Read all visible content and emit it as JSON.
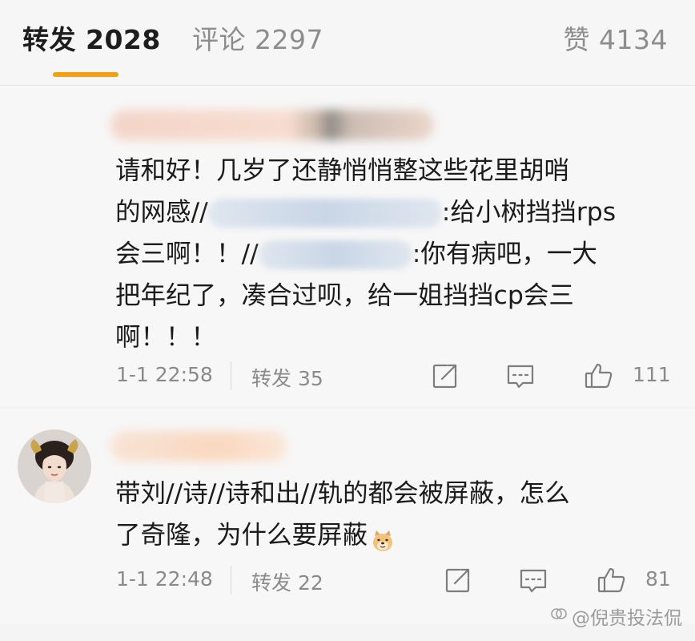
{
  "tabs": {
    "forward": "转发 2028",
    "comments": "评论 2297",
    "likes": "赞 4134"
  },
  "colors": {
    "accent": "#f1a213",
    "text": "#1b1b1b",
    "muted": "#8a8a8a"
  },
  "posts": [
    {
      "lines": {
        "l1": "请和好！几岁了还静悄悄整这些花里胡哨",
        "l2a": "的网感//",
        "l2b": ":给小树挡挡rps",
        "l3a": "会三啊！！//",
        "l3b": ":你有病吧，一大",
        "l4": "把年纪了，凑合过呗，给一姐挡挡cp会三",
        "l5": "啊！！！"
      },
      "timestamp": "1-1 22:58",
      "repost": "转发 35",
      "likes": "111"
    },
    {
      "lines": {
        "l1": "带刘//诗//诗和出//轨的都会被屏蔽，怎么",
        "l2": "了奇隆，为什么要屏蔽"
      },
      "timestamp": "1-1 22:48",
      "repost": "转发 22",
      "likes": "81"
    }
  ],
  "icons": {
    "share": "share-icon",
    "comment": "comment-icon",
    "like": "thumbs-up-icon",
    "emoji": "doge-emoji-icon"
  },
  "watermark": "@倪贵投法侃"
}
